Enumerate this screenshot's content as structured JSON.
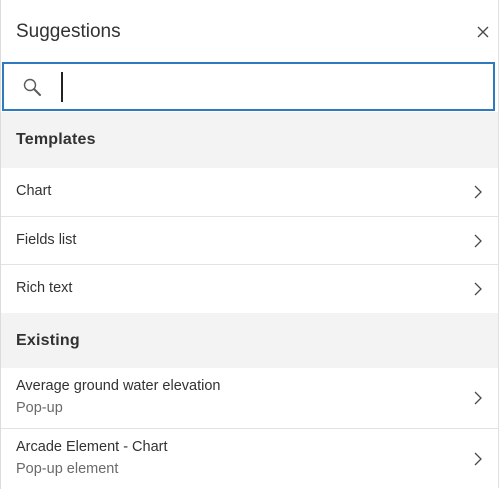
{
  "header": {
    "title": "Suggestions",
    "close_icon": "close-icon"
  },
  "search": {
    "value": "",
    "placeholder": "",
    "icon": "search-icon"
  },
  "groups": [
    {
      "title": "Templates",
      "items": [
        {
          "label": "Chart",
          "icon": "chevron-right-icon"
        },
        {
          "label": "Fields list",
          "icon": "chevron-right-icon"
        },
        {
          "label": "Rich text",
          "icon": "chevron-right-icon"
        }
      ]
    },
    {
      "title": "Existing",
      "items": [
        {
          "label": "Average ground water elevation",
          "sublabel": "Pop-up",
          "icon": "chevron-right-icon"
        },
        {
          "label": "Arcade Element - Chart",
          "sublabel": "Pop-up element",
          "icon": "chevron-right-icon"
        }
      ]
    }
  ],
  "colors": {
    "focus_border": "#2d7ac0",
    "group_header_bg": "#f3f3f3",
    "text": "#323232",
    "subtext": "#6a6a6a"
  }
}
